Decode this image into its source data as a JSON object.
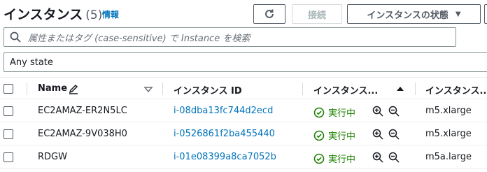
{
  "header": {
    "title": "インスタンス",
    "count": "(5)",
    "info_link": "情報",
    "connect_label": "接続",
    "instance_state_label": "インスタンスの状態"
  },
  "search": {
    "placeholder": "属性またはタグ (case-sensitive) で Instance を検索"
  },
  "state_filter": {
    "value": "Any state"
  },
  "table": {
    "columns": [
      "Name",
      "インスタンス ID",
      "インスタンス...",
      "インスタンス..."
    ],
    "rows": [
      {
        "name": "EC2AMAZ-ER2N5LC",
        "instance_id": "i-08dba13fc744d2ecd",
        "state": "実行中",
        "type": "m5.xlarge"
      },
      {
        "name": "EC2AMAZ-9V038H0",
        "instance_id": "i-0526861f2ba455440",
        "state": "実行中",
        "type": "m5.xlarge"
      },
      {
        "name": "RDGW",
        "instance_id": "i-01e08399a8ca7052b",
        "state": "実行中",
        "type": "m5a.large"
      }
    ]
  },
  "colors": {
    "link": "#0073bb",
    "running": "#1d8102"
  }
}
